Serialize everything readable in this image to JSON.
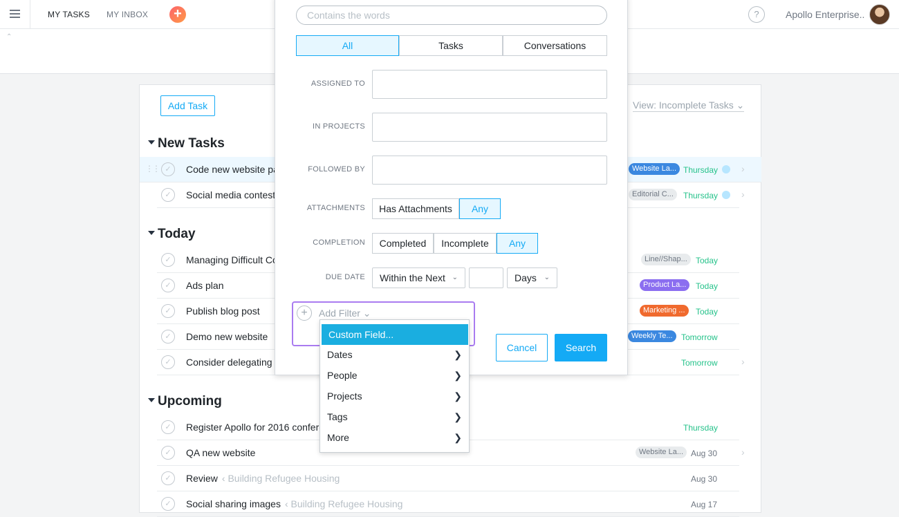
{
  "topbar": {
    "tabs": [
      "MY TASKS",
      "MY INBOX"
    ],
    "help": "?",
    "org": "Apollo Enterprise.."
  },
  "toolbar": {
    "add_task": "Add Task",
    "view": "View: Incomplete Tasks ⌄"
  },
  "sections": {
    "new_tasks": "New Tasks",
    "today": "Today",
    "upcoming": "Upcoming"
  },
  "tasks": [
    {
      "name": "Code new website pa",
      "tag": "Website La...",
      "tag_color": "#3b88e0",
      "date": "Thursday",
      "date_color": "green",
      "dot": true
    },
    {
      "name": "Social media contest",
      "tag": "Editorial C...",
      "tag_color": "#e8ebed",
      "date": "Thursday",
      "date_color": "green",
      "dot": true
    },
    {
      "name": "Managing Difficult Co",
      "tag": "Line//Shap...",
      "tag_color": "#e8ebed",
      "date": "Today",
      "date_color": "green"
    },
    {
      "name": "Ads plan",
      "tag": "Product La...",
      "tag_color": "#8b6ef0",
      "date": "Today",
      "date_color": "green"
    },
    {
      "name": "Publish blog post",
      "tag": "Marketing ...",
      "tag_color": "#f06a2e",
      "date": "Today",
      "date_color": "green"
    },
    {
      "name": "Demo new website",
      "tag": "Weekly Te...",
      "tag_color": "#3b88e0",
      "date": "Tomorrow",
      "date_color": "green"
    },
    {
      "name": "Consider delegating",
      "date": "Tomorrow",
      "date_color": "green"
    },
    {
      "name": "Register Apollo for 2016 confere",
      "date": "Thursday",
      "date_color": "green"
    },
    {
      "name": "QA new website",
      "tag": "Website La...",
      "tag_color": "#e8ebed",
      "date": "Aug 30",
      "date_color": "gray"
    },
    {
      "name": "Review",
      "project": "‹ Building Refugee Housing",
      "date": "Aug 30",
      "date_color": "gray"
    },
    {
      "name": "Social sharing images",
      "project": "‹ Building Refugee Housing",
      "date": "Aug 17",
      "date_color": "gray"
    }
  ],
  "search": {
    "placeholder": "Contains the words",
    "segments": [
      "All",
      "Tasks",
      "Conversations"
    ],
    "labels": {
      "assigned_to": "ASSIGNED TO",
      "in_projects": "IN PROJECTS",
      "followed_by": "FOLLOWED BY",
      "attachments": "ATTACHMENTS",
      "completion": "COMPLETION",
      "due_date": "DUE DATE"
    },
    "attachments_opts": [
      "Has Attachments",
      "Any"
    ],
    "completion_opts": [
      "Completed",
      "Incomplete",
      "Any"
    ],
    "due_within": "Within the Next",
    "due_unit": "Days",
    "add_filter": "Add Filter ⌄",
    "cancel": "Cancel",
    "search": "Search"
  },
  "filter_menu": [
    "Custom Field...",
    "Dates",
    "People",
    "Projects",
    "Tags",
    "More"
  ]
}
